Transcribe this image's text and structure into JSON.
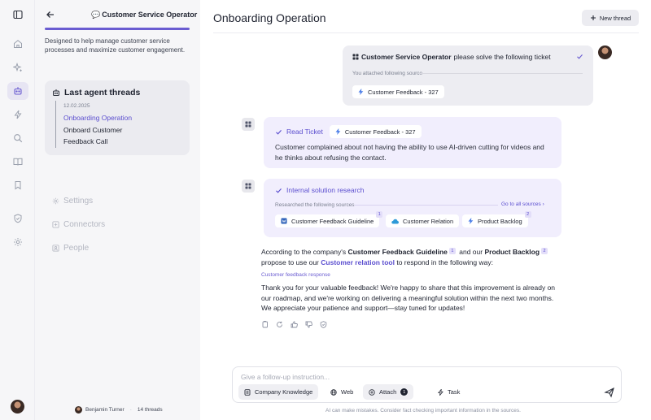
{
  "sidebar_rail": {
    "items": [
      {
        "name": "panel-toggle-icon"
      },
      {
        "name": "home-icon"
      },
      {
        "name": "sparkles-icon"
      },
      {
        "name": "agent-bot-icon",
        "active": true
      },
      {
        "name": "lightning-icon"
      },
      {
        "name": "search-icon"
      },
      {
        "name": "book-icon"
      },
      {
        "name": "bookmark-icon"
      },
      {
        "name": "shield-icon"
      },
      {
        "name": "settings-gear-icon"
      }
    ]
  },
  "panel": {
    "agent_icon": "💬",
    "agent_name": "Customer Service Operator",
    "description": "Designed to help manage customer service processes and maximize customer engagement.",
    "threads_title": "Last agent threads",
    "thread_date": "12.02.2025",
    "threads": [
      {
        "label": "Onboarding Operation",
        "active": true
      },
      {
        "label": "Onboard Customer",
        "active": false
      },
      {
        "label": "Feedback Call",
        "active": false
      }
    ],
    "links": {
      "settings": "Settings",
      "connectors": "Connectors",
      "people": "People"
    },
    "footer": {
      "user_name": "Benjamin Turner",
      "thread_count": "14 threads"
    }
  },
  "main": {
    "title": "Onboarding Operation",
    "new_thread_label": "New thread"
  },
  "user_message": {
    "agent_name": "Customer Service Operator",
    "text": "please solve the following ticket",
    "attached_label": "You attached following source",
    "attachment": "Customer Feedback - 327"
  },
  "step_read": {
    "title": "Read Ticket",
    "chip": "Customer Feedback - 327",
    "body": "Customer complained about not having the ability to use AI-driven cutting for videos and he thinks about refusing the contact."
  },
  "step_research": {
    "title": "Internal solution research",
    "sources_label": "Researched the following sources",
    "go_to_sources": "Go to all sources",
    "sources": [
      {
        "label": "Customer Feedback Guideline",
        "badge": "1"
      },
      {
        "label": "Customer Relation",
        "badge": ""
      },
      {
        "label": "Product Backlog",
        "badge": "2"
      }
    ]
  },
  "answer": {
    "p1": "According to the company's",
    "src1": "Customer Feedback Guideline",
    "src1_badge": "1",
    "p2": "and our",
    "src2": "Product Backlog",
    "src2_badge": "2",
    "p3": "propose to use our",
    "tool": "Customer relation tool",
    "p4": "to respond in the following way:",
    "response_label": "Customer feedback response",
    "response": "Thank you for your valuable feedback! We're happy to share that this improvement is already on our roadmap, and we're working on delivering a meaningful solution within the next two months. We appreciate your patience and support—stay tuned for updates!"
  },
  "composer": {
    "placeholder": "Give a follow-up instruction...",
    "company_knowledge": "Company Knowledge",
    "web": "Web",
    "attach": "Attach",
    "attach_count": "1",
    "task": "Task",
    "disclaimer": "AI can make mistakes. Consider fact checking important information in the sources."
  },
  "colors": {
    "accent": "#6a5cd1",
    "panel_bg": "#f6f6f8",
    "step_bg": "#f1eefd"
  }
}
